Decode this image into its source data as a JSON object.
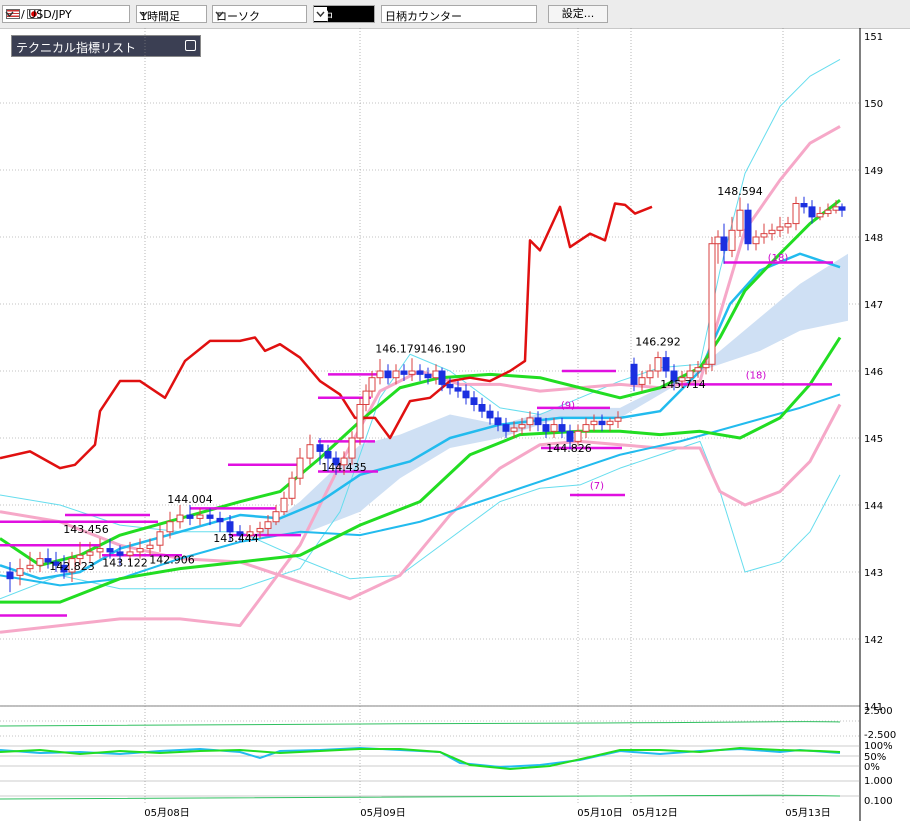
{
  "toolbar": {
    "symbol": "/ USD/JPY",
    "timeframe": "1時間足",
    "chart_style": "ローソク",
    "size_label": "中",
    "brand_counter": "日柄カウンター",
    "settings": "設定..."
  },
  "indicator_panel": {
    "title": "テクニカル指標リスト"
  },
  "colors": {
    "up_candle": "#d84040",
    "down_candle": "#1b2fe0",
    "price_line": "#e01010",
    "ma_short": "#22dd22",
    "ma_long": "#22bbee",
    "bollinger_inner": "#f6a8c8",
    "bollinger_outer": "#66ddee",
    "cloud": "#cfe0f4",
    "level_lines": "#e010e0"
  },
  "chart_data": {
    "type": "candlestick",
    "symbol": "USD/JPY",
    "ylim": [
      141,
      151
    ],
    "yticks": [
      141,
      142,
      143,
      144,
      145,
      146,
      147,
      148,
      149,
      150,
      151
    ],
    "xticks": [
      "05月08日",
      "05月09日",
      "05月10日",
      "05月12日",
      "05月13日"
    ],
    "price_labels": [
      "142.823",
      "143.456",
      "143.122",
      "142.906",
      "144.004",
      "143.444",
      "144.435",
      "146.179",
      "146.190",
      "144.826",
      "146.292",
      "145.714",
      "148.594"
    ],
    "count_labels": [
      "(9)",
      "(7)",
      "(18)",
      "(18)"
    ],
    "oscillator_labels": {
      "upper": [
        "2.500",
        "-2.500"
      ],
      "lower": [
        "100%",
        "50%",
        "0%",
        "1.000",
        "0.100"
      ]
    }
  }
}
